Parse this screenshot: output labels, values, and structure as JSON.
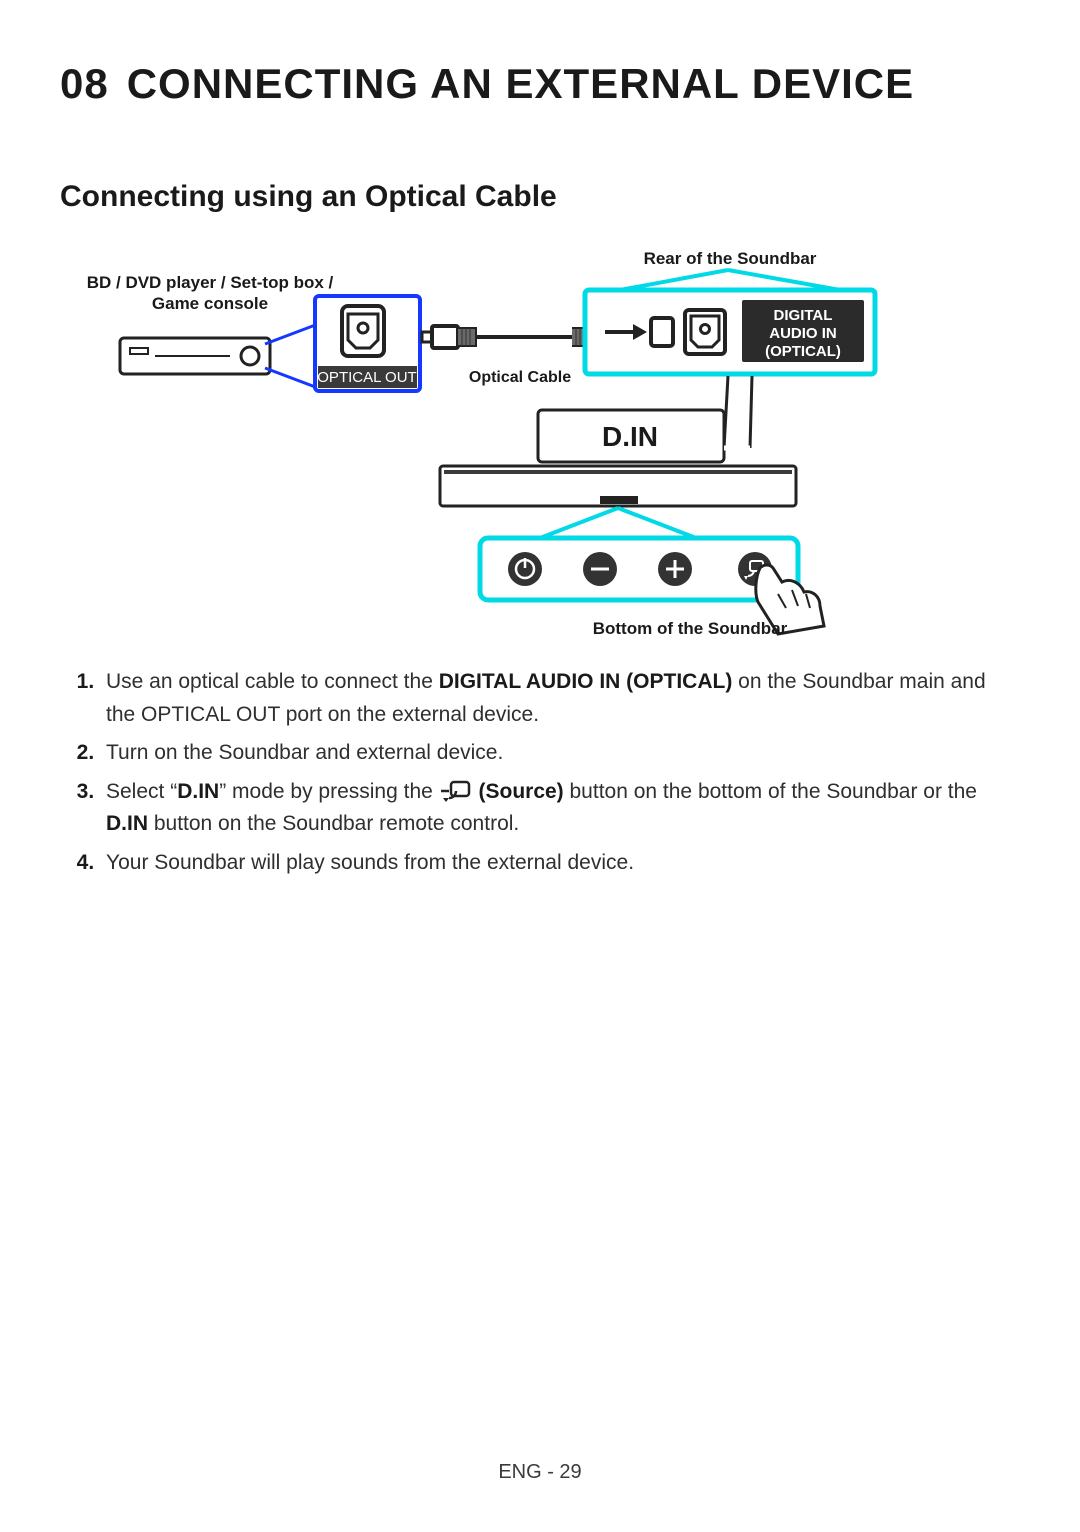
{
  "chapter": {
    "number": "08",
    "title": "CONNECTING AN EXTERNAL DEVICE"
  },
  "section": {
    "title": "Connecting using an Optical Cable"
  },
  "diagram": {
    "source_device_label": "BD / DVD player / Set-top box / Game console",
    "rear_label": "Rear of the Soundbar",
    "optical_out": "OPTICAL OUT",
    "cable_label": "Optical Cable",
    "din_port_label_line1": "DIGITAL",
    "din_port_label_line2": "AUDIO IN",
    "din_port_label_line3": "(OPTICAL)",
    "din_mode": "D.IN",
    "bottom_label": "Bottom of the Soundbar"
  },
  "steps": {
    "s1_a": "Use an optical cable to connect the ",
    "s1_b": "DIGITAL AUDIO IN (OPTICAL)",
    "s1_c": " on the Soundbar main and the OPTICAL OUT port on the external device.",
    "s2": "Turn on the Soundbar and external device.",
    "s3_a": "Select “",
    "s3_b": "D.IN",
    "s3_c": "” mode by pressing the ",
    "s3_d": " (Source)",
    "s3_e": " button on the bottom of the Soundbar or the ",
    "s3_f": "D.IN",
    "s3_g": " button on the Soundbar remote control.",
    "s4": "Your Soundbar will play sounds from the external device."
  },
  "footer": "ENG - 29"
}
